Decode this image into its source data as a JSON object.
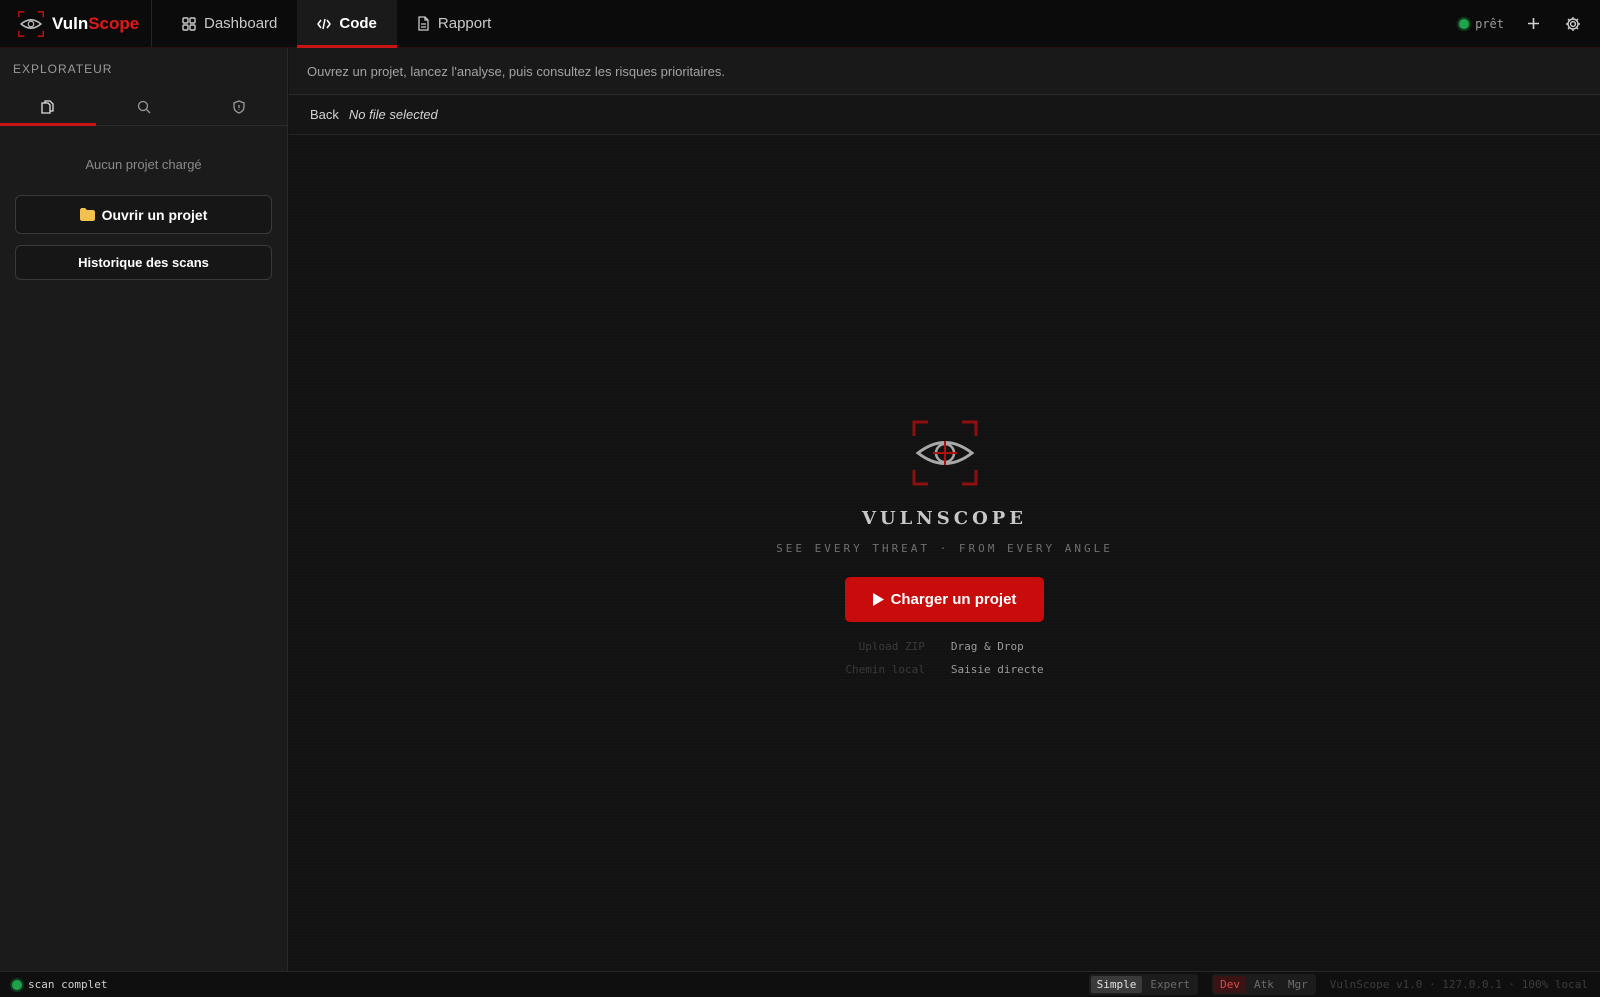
{
  "app": {
    "name_prefix": "Vuln",
    "name_suffix": "Scope",
    "accent_color": "#c80b0b"
  },
  "header": {
    "tabs": [
      {
        "label": "Dashboard",
        "icon": "grid-icon",
        "active": false
      },
      {
        "label": "Code",
        "icon": "code-icon",
        "active": true
      },
      {
        "label": "Rapport",
        "icon": "document-icon",
        "active": false
      }
    ],
    "status_label": "prêt",
    "status_color": "#1fa34a"
  },
  "sidebar": {
    "title": "EXPLORATEUR",
    "tabs": [
      {
        "icon": "files-icon",
        "active": true
      },
      {
        "icon": "search-icon",
        "active": false
      },
      {
        "icon": "shield-icon",
        "active": false
      }
    ],
    "empty_message": "Aucun projet chargé",
    "open_button": "Ouvrir un projet",
    "history_button": "Historique des scans"
  },
  "main": {
    "hint": "Ouvrez un projet, lancez l'analyse, puis consultez les risques prioritaires.",
    "back_label": "Back",
    "file_label": "No file selected",
    "hero": {
      "title": "VULNSCOPE",
      "tagline": "SEE EVERY THREAT · FROM EVERY ANGLE",
      "cta_label": "Charger un projet",
      "options": [
        {
          "key": "Upload ZIP",
          "value": "Drag & Drop"
        },
        {
          "key": "Chemin local",
          "value": "Saisie directe"
        }
      ]
    }
  },
  "statusbar": {
    "left_text": "scan complet",
    "modes": {
      "simple": "Simple",
      "expert": "Expert",
      "selected": "Simple"
    },
    "roles": {
      "dev": "Dev",
      "atk": "Atk",
      "mgr": "Mgr",
      "selected": "Dev"
    },
    "info": "VulnScope v1.0 · 127.0.0.1 · 100% local"
  }
}
